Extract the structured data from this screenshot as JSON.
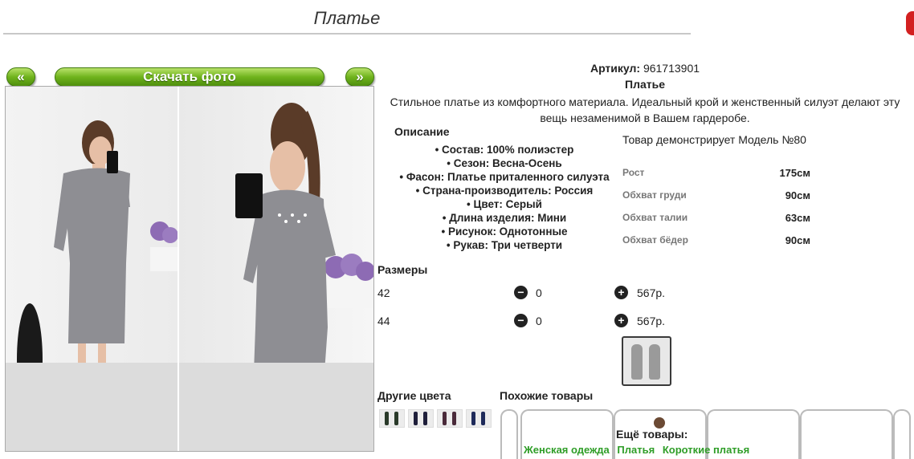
{
  "page": {
    "title": "Платье"
  },
  "gallery": {
    "prev": "«",
    "download": "Скачать фото",
    "next": "»"
  },
  "product": {
    "article_label": "Артикул:",
    "article_value": "961713901",
    "name": "Платье",
    "description": "Стильное платье из комфортного материала. Идеальный крой и женственный силуэт делают эту вещь незаменимой в Вашем гардеробе.",
    "desc_title": "Описание",
    "desc_items": [
      "• Состав: 100% полиэстер",
      "• Сезон: Весна-Осень",
      "• Фасон: Платье приталенного силуэта",
      "• Страна-производитель: Россия",
      "• Цвет: Серый",
      "• Длина изделия: Мини",
      "• Рисунок: Однотонные",
      "• Рукав: Три четверти"
    ],
    "model_title": "Товар демонстрирует Модель №80",
    "model_params": [
      {
        "label": "Рост",
        "value": "175см"
      },
      {
        "label": "Обхват груди",
        "value": "90см"
      },
      {
        "label": "Обхват талии",
        "value": "63см"
      },
      {
        "label": "Обхват бёдер",
        "value": "90см"
      }
    ]
  },
  "sizes": {
    "title": "Размеры",
    "rows": [
      {
        "size": "42",
        "minus": "−",
        "qty": "0",
        "plus": "+",
        "price": "567р."
      },
      {
        "size": "44",
        "minus": "−",
        "qty": "0",
        "plus": "+",
        "price": "567р."
      }
    ]
  },
  "other_colors": {
    "title": "Другие цвета"
  },
  "similar": {
    "title": "Похожие товары"
  },
  "more": {
    "label": "Ещё товары:",
    "links": [
      "Женская одежда",
      "Платья",
      "Короткие платья"
    ]
  },
  "colors": {
    "accent_green": "#6fb31c",
    "link_green": "#2e9d27",
    "corner_red": "#d32020"
  }
}
